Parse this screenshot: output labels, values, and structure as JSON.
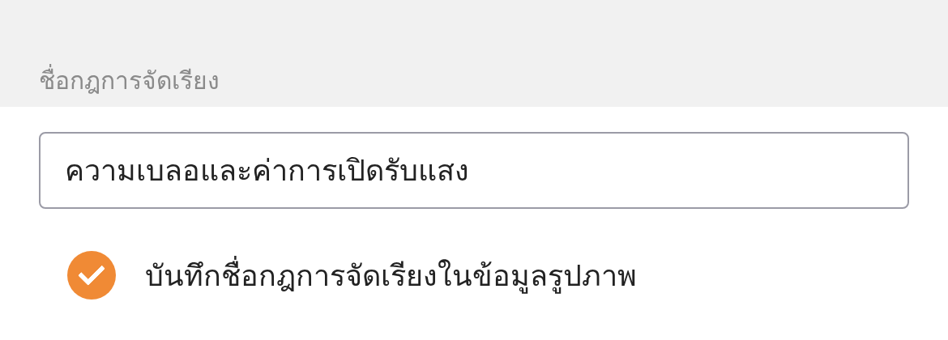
{
  "section_header": "ชื่อกฎการจัดเรียง",
  "name_field": {
    "value": "ความเบลอและค่าการเปิดรับแสง"
  },
  "save_option": {
    "label": "บันทึกชื่อกฎการจัดเรียงในข้อมูลรูปภาพ",
    "checked": true
  }
}
